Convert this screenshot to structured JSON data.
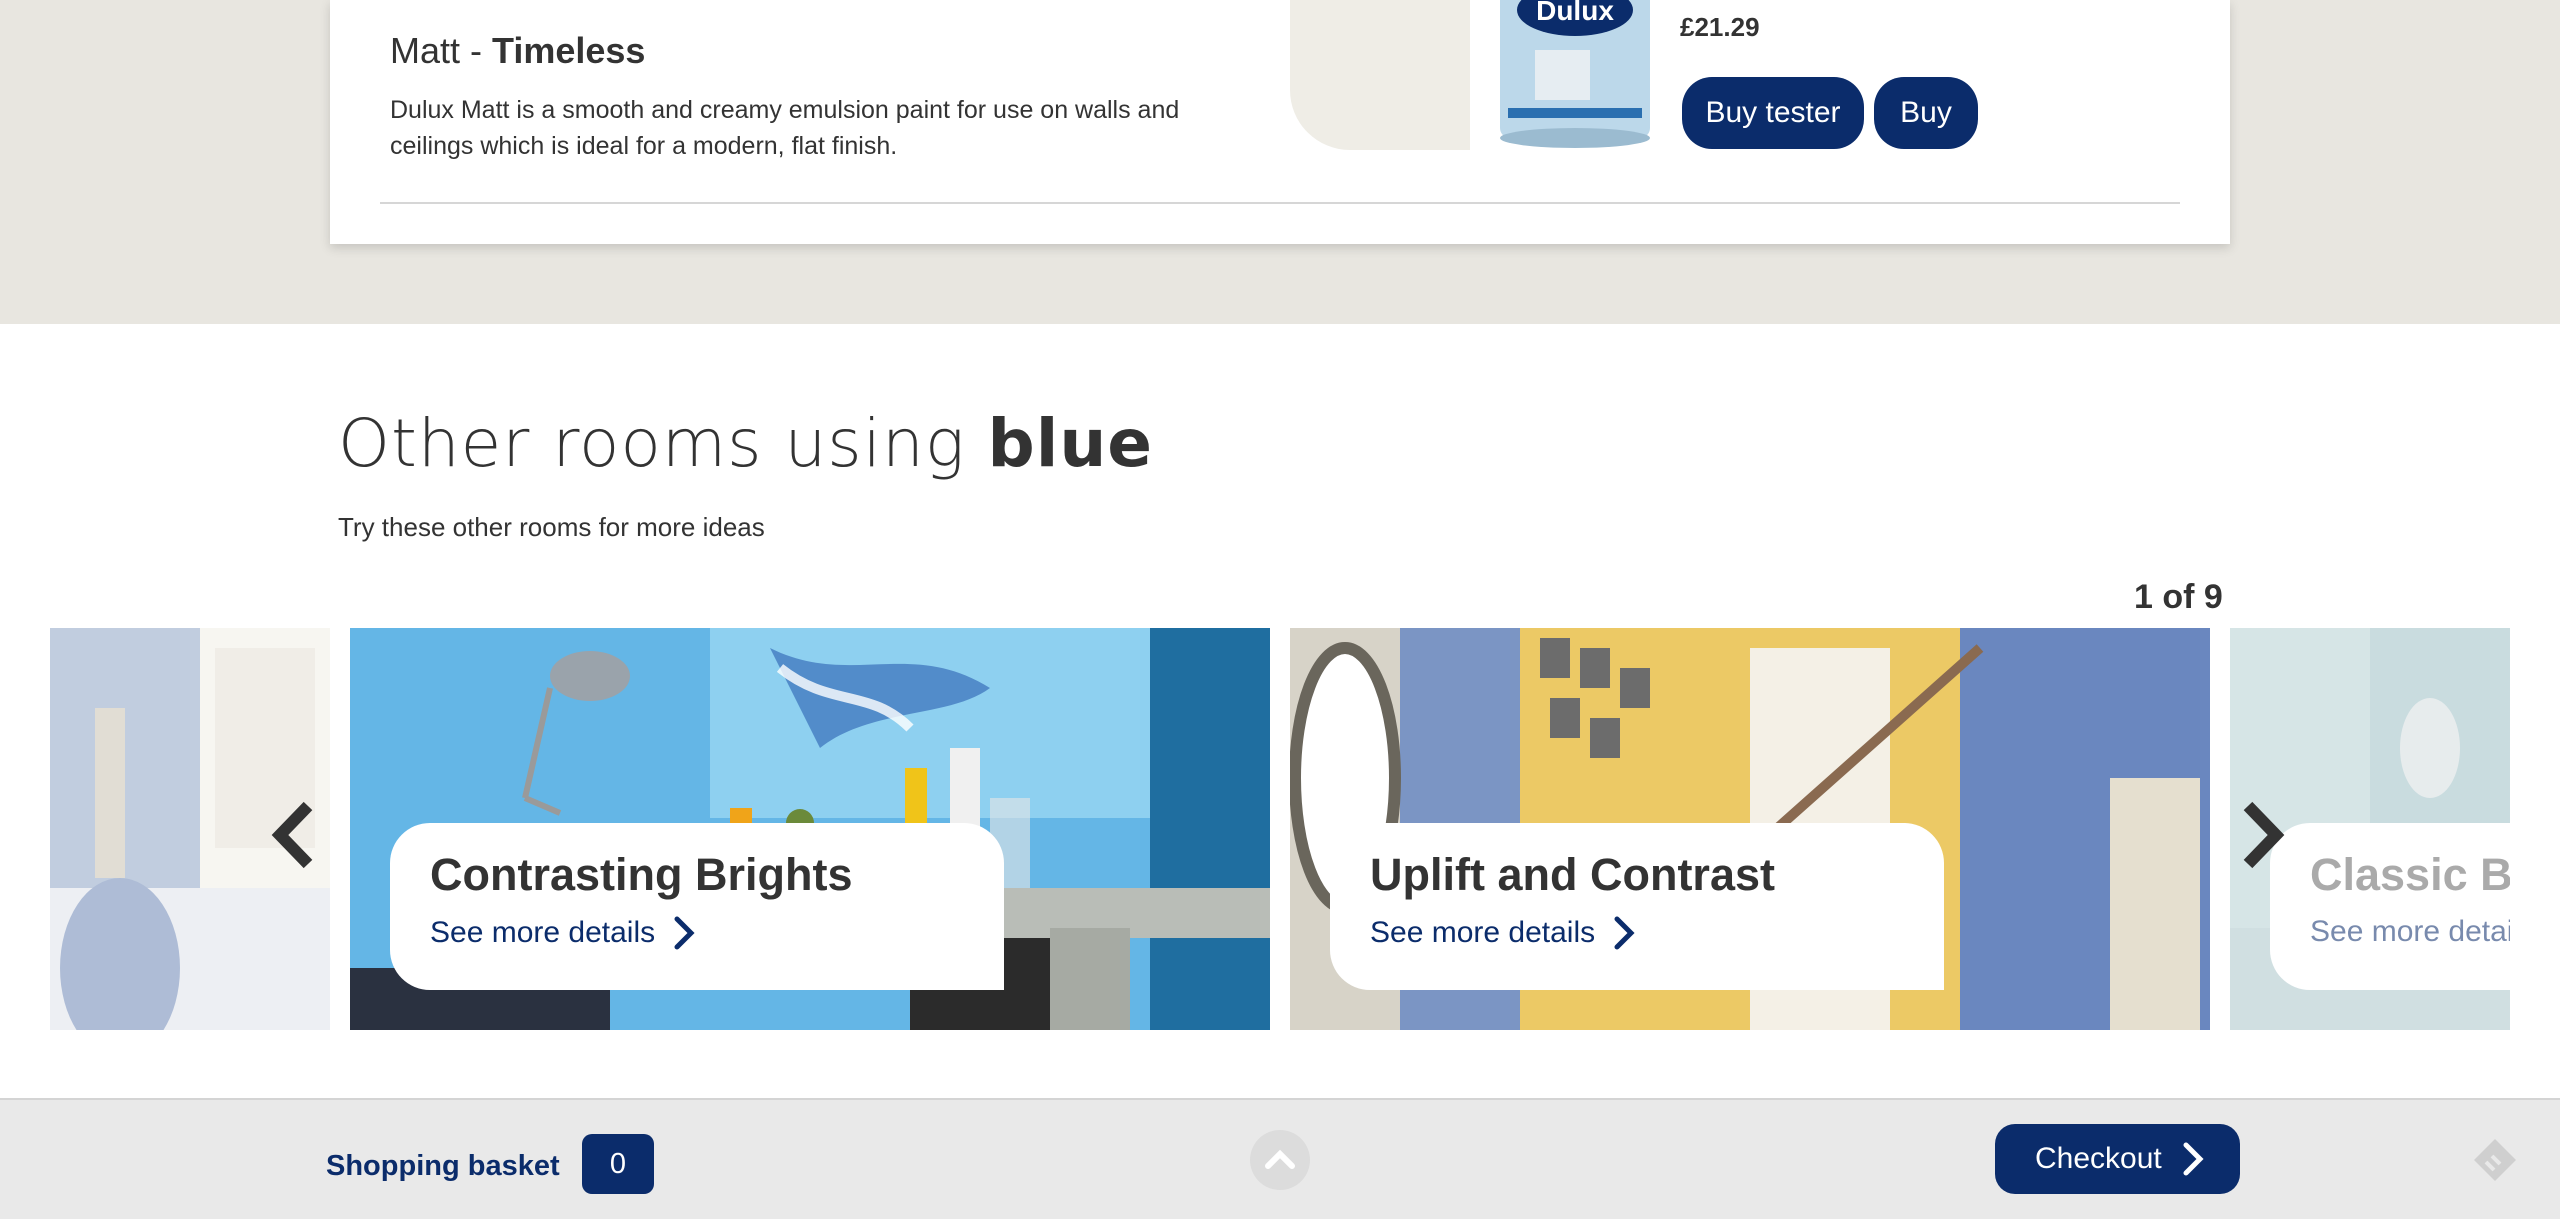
{
  "product": {
    "finish_prefix": "Matt - ",
    "finish_name": "Timeless",
    "description": "Dulux Matt is a smooth and creamy emulsion paint for use on walls and ceilings which is ideal for a modern, flat finish.",
    "price": "£21.29",
    "buy_tester_label": "Buy tester",
    "buy_label": "Buy",
    "can_brand": "Dulux"
  },
  "rooms": {
    "title_prefix": "Other rooms using ",
    "title_accent": "blue",
    "subtitle": "Try these other rooms for more ideas",
    "pager": "1 of 9",
    "slides": [
      {
        "title": "Contrasting Brights",
        "link": "See more details"
      },
      {
        "title": "Uplift and Contrast",
        "link": "See more details"
      },
      {
        "title": "Classic Bl",
        "link": "See more detail"
      }
    ]
  },
  "footer": {
    "basket_label": "Shopping basket",
    "basket_count": "0",
    "checkout_label": "Checkout"
  },
  "colors": {
    "brand_navy": "#0b2c6b",
    "band_beige": "#e8e6e0",
    "footer_grey": "#e9e9e9"
  },
  "icons": [
    "chevron-left-icon",
    "chevron-right-icon",
    "chevron-up-icon",
    "tag-icon",
    "paint-can-image"
  ]
}
